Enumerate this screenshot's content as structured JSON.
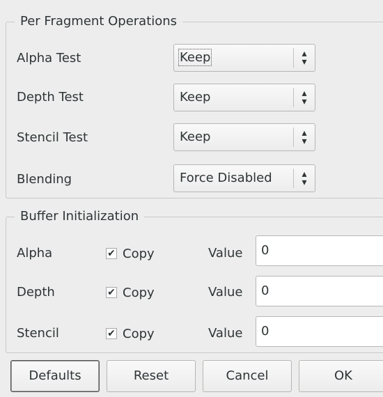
{
  "per_fragment": {
    "title": "Per Fragment Operations",
    "rows": [
      {
        "label": "Alpha Test",
        "value": "Keep"
      },
      {
        "label": "Depth Test",
        "value": "Keep"
      },
      {
        "label": "Stencil Test",
        "value": "Keep"
      },
      {
        "label": "Blending",
        "value": "Force Disabled"
      }
    ]
  },
  "buffer_init": {
    "title": "Buffer Initialization",
    "copy_label": "Copy",
    "value_label": "Value",
    "rows": [
      {
        "label": "Alpha",
        "copy_checked": true,
        "value": "0"
      },
      {
        "label": "Depth",
        "copy_checked": true,
        "value": "0"
      },
      {
        "label": "Stencil",
        "copy_checked": true,
        "value": "0"
      }
    ]
  },
  "buttons": {
    "defaults": "Defaults",
    "reset": "Reset",
    "cancel": "Cancel",
    "ok": "OK"
  },
  "icons": {
    "combo_arrows": "up-down-arrows-icon",
    "checkmark": "checkmark-icon"
  }
}
